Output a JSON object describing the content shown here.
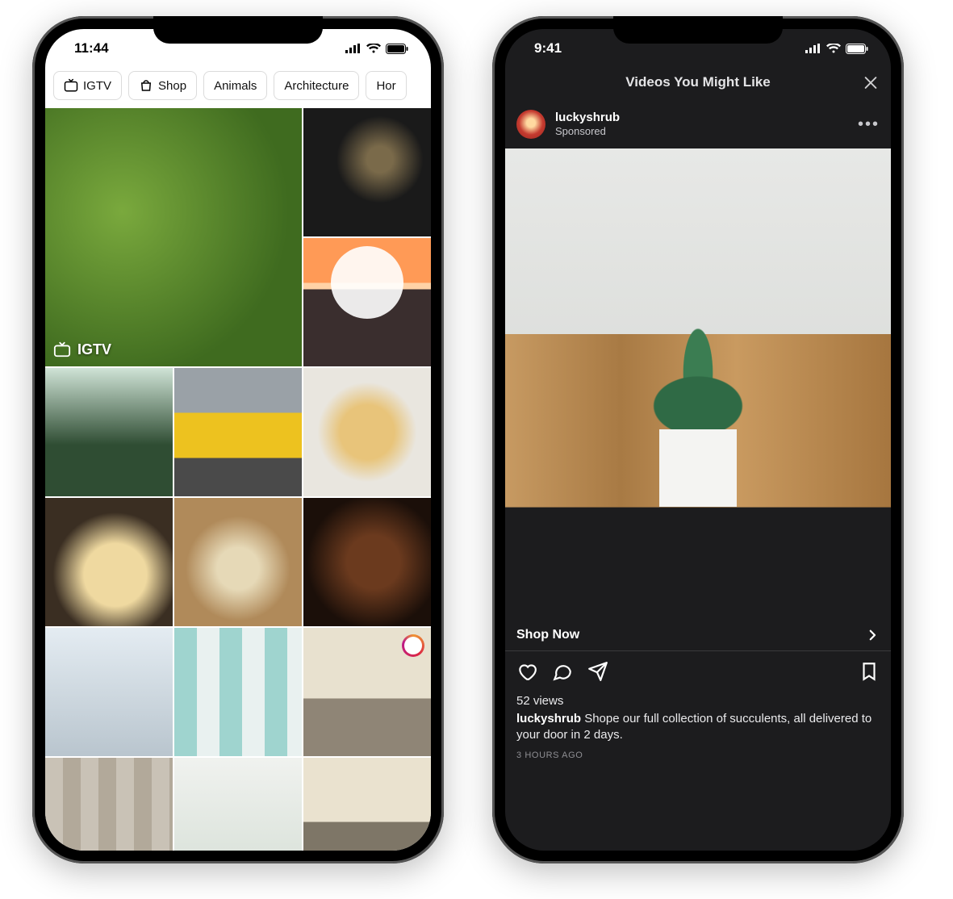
{
  "phone1": {
    "status": {
      "time": "11:44"
    },
    "chips": [
      {
        "label": "IGTV",
        "icon": "igtv"
      },
      {
        "label": "Shop",
        "icon": "shop"
      },
      {
        "label": "Animals"
      },
      {
        "label": "Architecture"
      },
      {
        "label": "Hor"
      }
    ],
    "featured_badge": "IGTV"
  },
  "phone2": {
    "status": {
      "time": "9:41"
    },
    "title": "Videos You Might Like",
    "post": {
      "username": "luckyshrub",
      "sponsored_label": "Sponsored",
      "cta": "Shop Now",
      "views_text": "52 views",
      "caption_user": "luckyshrub",
      "caption_text": " Shope our full collection of succulents, all delivered to your door in 2 days.",
      "timestamp": "3 HOURS AGO"
    }
  }
}
